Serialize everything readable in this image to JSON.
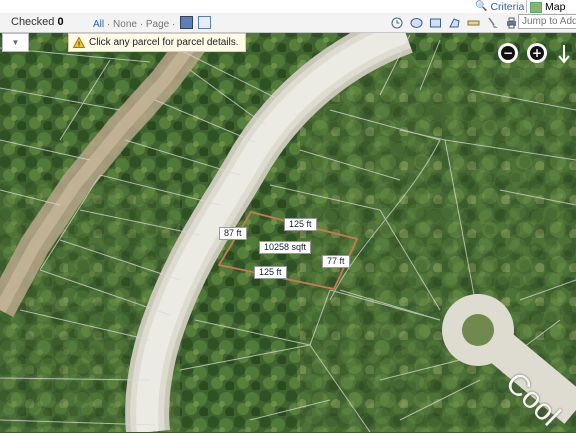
{
  "toolbar": {
    "checked_label": "Checked",
    "checked_count": "0",
    "select_all": "All",
    "select_none": "None",
    "select_page": "Page",
    "sep": "·",
    "jump_placeholder": "Jump to Addr"
  },
  "tabs": {
    "criteria": "Criteria",
    "map": "Map"
  },
  "hint": {
    "text": "Click any parcel for parcel details."
  },
  "dropdown": {
    "symbol": "▼"
  },
  "zoom": {
    "out": "−",
    "in": "+"
  },
  "parcel": {
    "top": "125 ft",
    "bottom": "125 ft",
    "left": "87 ft",
    "right": "77 ft",
    "area": "10258 sqft"
  },
  "street_label": "Cool"
}
